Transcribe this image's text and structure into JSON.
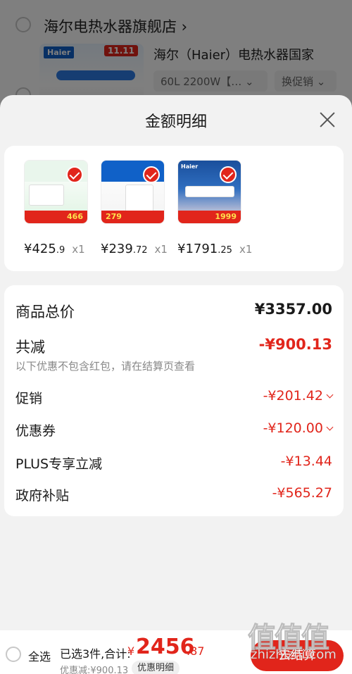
{
  "background": {
    "store_name": "海尔电热水器旗舰店 ›",
    "product_title": "海尔（Haier）电热水器国家",
    "product_logo": "Haier",
    "product_tag": "11.11",
    "sku_text": "60L 2200W【… ⌄",
    "promo_text": "换促销 ⌄"
  },
  "sheet": {
    "title": "金额明细",
    "items": [
      {
        "price_main": "¥425",
        "price_dec": ".9",
        "qty": "x1",
        "badge": "466"
      },
      {
        "price_main": "¥239",
        "price_dec": ".72",
        "qty": "x1",
        "badge": "279"
      },
      {
        "price_main": "¥1791",
        "price_dec": ".25",
        "qty": "x1",
        "badge": "1999"
      }
    ],
    "summary": {
      "total_label": "商品总价",
      "total_value": "¥3357.00",
      "reduce_label": "共减",
      "reduce_value": "-¥900.13",
      "reduce_note": "以下优惠不包含红包，请在结算页查看",
      "promo_label": "促销",
      "promo_value": "-¥201.42",
      "coupon_label": "优惠券",
      "coupon_value": "-¥120.00",
      "plus_label": "PLUS专享立减",
      "plus_value": "-¥13.44",
      "subsidy_label": "政府补贴",
      "subsidy_value": "-¥565.27"
    }
  },
  "bottom": {
    "select_all": "全选",
    "selected_text": "已选3件,合计:",
    "total_yen": "¥",
    "total_int": "2456",
    "total_dec": ".87",
    "discount_text": "优惠减:¥900.13",
    "detail_chip": "优惠明细",
    "checkout": "去结算"
  },
  "watermark": {
    "logo": "值值值",
    "url": "zhizhizhi.com"
  },
  "colors": {
    "accent": "#e1251b",
    "sheet_bg": "#f2f2f2",
    "card_bg": "#ffffff"
  }
}
